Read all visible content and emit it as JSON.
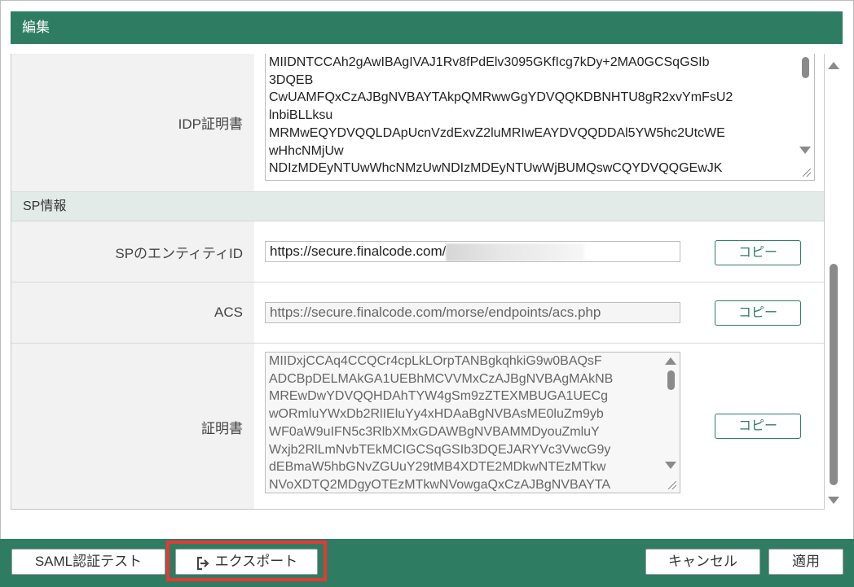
{
  "dialog": {
    "title": "編集"
  },
  "idp": {
    "cert_label": "IDP証明書",
    "cert_lines": [
      "MIIDNTCCAh2gAwIBAgIVAJ1Rv8fPdElv3095GKfIcg7kDy+2MA0GCSqGSIb",
      "3DQEB",
      "CwUAMFQxCzAJBgNVBAYTAkpQMRwwGgYDVQQKDBNHTU8gR2xvYmFsU2",
      "lnbiBLLksu",
      "MRMwEQYDVQQLDApUcnVzdExvZ2luMRIwEAYDVQQDDAl5YW5hc2UtcWE",
      "wHhcNMjUw",
      "NDIzMDEyNTUwWhcNMzUwNDIzMDEyNTUwWjBUMQswCQYDVQQGEwJK"
    ]
  },
  "sp": {
    "section_title": "SP情報",
    "entity_label": "SPのエンティティID",
    "entity_value": "https://secure.finalcode.com/",
    "acs_label": "ACS",
    "acs_value": "https://secure.finalcode.com/morse/endpoints/acs.php",
    "cert_label": "証明書",
    "cert_lines": [
      "MIIDxjCCAq4CCQCr4cpLkLOrpTANBgkqhkiG9w0BAQsF",
      "ADCBpDELMAkGA1UEBhMCVVMxCzAJBgNVBAgMAkNB",
      "MREwDwYDVQQHDAhTYW4gSm9zZTEXMBUGA1UECg",
      "wORmluYWxDb2RlIEluYy4xHDAaBgNVBAsME0luZm9yb",
      "WF0aW9uIFN5c3RlbXMxGDAWBgNVBAMMDyouZmluY",
      "Wxjb2RlLmNvbTEkMCIGCSqGSIb3DQEJARYVc3VwcG9y",
      "dEBmaW5hbGNvZGUuY29tMB4XDTE2MDkwNTEzMTkw",
      "NVoXDTQ2MDgyOTEzMTkwNVowgaQxCzAJBgNVBAYTA"
    ],
    "copy_label": "コピー"
  },
  "footer": {
    "saml_test_label": "SAML認証テスト",
    "export_label": "エクスポート",
    "cancel_label": "キャンセル",
    "apply_label": "適用"
  },
  "colors": {
    "accent": "#2e7d62",
    "highlight": "#e53935"
  },
  "icons": {
    "export": "export-icon"
  }
}
